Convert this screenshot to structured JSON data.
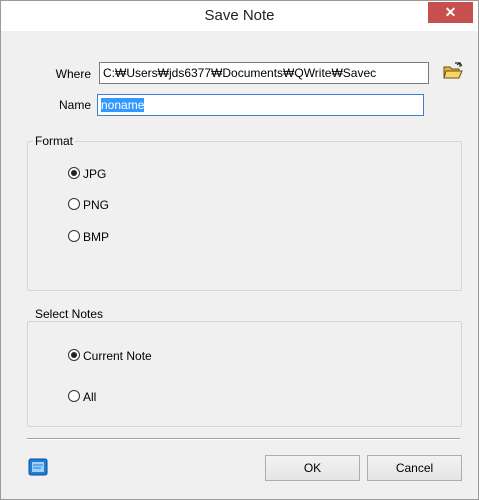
{
  "window": {
    "title": "Save Note",
    "close_glyph": "✕"
  },
  "where": {
    "label": "Where",
    "value": "C:₩Users₩jds6377₩Documents₩QWrite₩Savec",
    "folder_icon": "folder-open-icon"
  },
  "name": {
    "label": "Name",
    "value": "noname"
  },
  "format": {
    "title": "Format",
    "options": [
      {
        "label": "JPG",
        "selected": true
      },
      {
        "label": "PNG",
        "selected": false
      },
      {
        "label": "BMP",
        "selected": false
      }
    ]
  },
  "select_notes": {
    "title": "Select Notes",
    "options": [
      {
        "label": "Current Note",
        "selected": true
      },
      {
        "label": "All",
        "selected": false
      }
    ]
  },
  "footer": {
    "note_icon": "note-icon",
    "ok_label": "OK",
    "cancel_label": "Cancel"
  },
  "colors": {
    "close_button": "#c74f4f",
    "selection": "#3399ff",
    "focus_border": "#3a7fd5"
  }
}
